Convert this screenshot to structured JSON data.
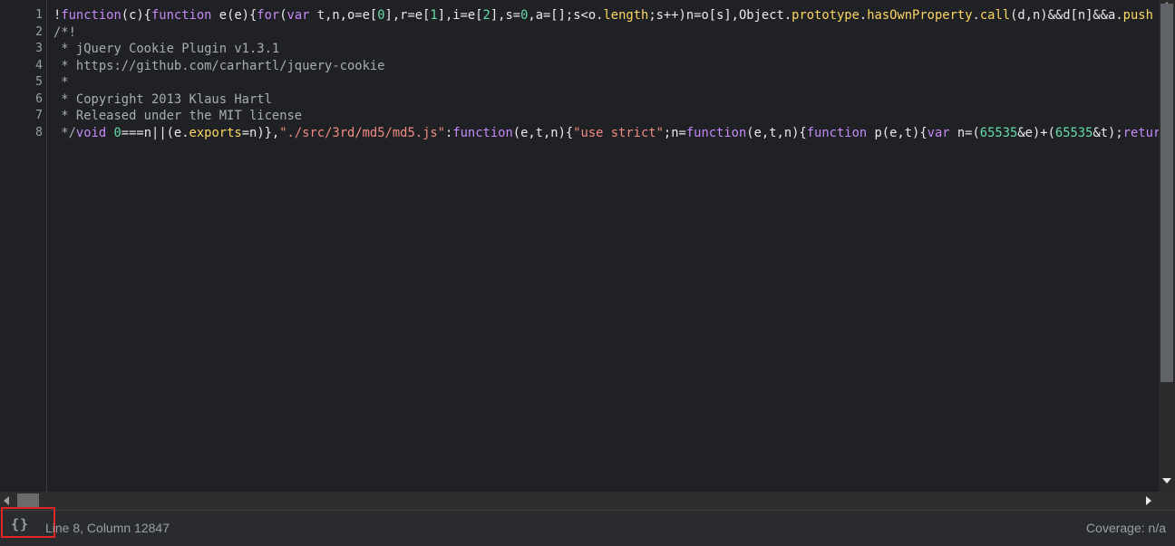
{
  "editor": {
    "line_numbers": [
      "1",
      "2",
      "3",
      "4",
      "5",
      "6",
      "7",
      "8"
    ],
    "lines": [
      [
        {
          "t": "!",
          "c": "pl"
        },
        {
          "t": "function",
          "c": "kw"
        },
        {
          "t": "(c){",
          "c": "pl"
        },
        {
          "t": "function",
          "c": "kw"
        },
        {
          "t": " e(e){",
          "c": "pl"
        },
        {
          "t": "for",
          "c": "kw"
        },
        {
          "t": "(",
          "c": "pl"
        },
        {
          "t": "var",
          "c": "kw"
        },
        {
          "t": " t,n,o=e[",
          "c": "pl"
        },
        {
          "t": "0",
          "c": "num"
        },
        {
          "t": "],r=e[",
          "c": "pl"
        },
        {
          "t": "1",
          "c": "num"
        },
        {
          "t": "],i=e[",
          "c": "pl"
        },
        {
          "t": "2",
          "c": "num"
        },
        {
          "t": "],s=",
          "c": "pl"
        },
        {
          "t": "0",
          "c": "num"
        },
        {
          "t": ",a=[];s<o.",
          "c": "pl"
        },
        {
          "t": "length",
          "c": "prop"
        },
        {
          "t": ";s++)n=o[s],Object.",
          "c": "pl"
        },
        {
          "t": "prototype",
          "c": "prop"
        },
        {
          "t": ".",
          "c": "pl"
        },
        {
          "t": "hasOwnProperty",
          "c": "prop"
        },
        {
          "t": ".",
          "c": "pl"
        },
        {
          "t": "call",
          "c": "prop"
        },
        {
          "t": "(d,n)&&d[n]&&a.",
          "c": "pl"
        },
        {
          "t": "push",
          "c": "prop"
        }
      ],
      [
        {
          "t": "/*!",
          "c": "cm"
        }
      ],
      [
        {
          "t": " * jQuery Cookie Plugin v1.3.1",
          "c": "cm"
        }
      ],
      [
        {
          "t": " * https://github.com/carhartl/jquery-cookie",
          "c": "cm"
        }
      ],
      [
        {
          "t": " *",
          "c": "cm"
        }
      ],
      [
        {
          "t": " * Copyright 2013 Klaus Hartl",
          "c": "cm"
        }
      ],
      [
        {
          "t": " * Released under the MIT license",
          "c": "cm"
        }
      ],
      [
        {
          "t": " */",
          "c": "cm"
        },
        {
          "t": "void",
          "c": "kw"
        },
        {
          "t": " ",
          "c": "pl"
        },
        {
          "t": "0",
          "c": "num"
        },
        {
          "t": "===n||(e.",
          "c": "pl"
        },
        {
          "t": "exports",
          "c": "prop"
        },
        {
          "t": "=n)},",
          "c": "pl"
        },
        {
          "t": "\"./src/3rd/md5/md5.js\"",
          "c": "str"
        },
        {
          "t": ":",
          "c": "pl"
        },
        {
          "t": "function",
          "c": "kw"
        },
        {
          "t": "(e,t,n){",
          "c": "pl"
        },
        {
          "t": "\"use strict\"",
          "c": "str"
        },
        {
          "t": ";n=",
          "c": "pl"
        },
        {
          "t": "function",
          "c": "kw"
        },
        {
          "t": "(e,t,n){",
          "c": "pl"
        },
        {
          "t": "function",
          "c": "kw"
        },
        {
          "t": " p(e,t){",
          "c": "pl"
        },
        {
          "t": "var",
          "c": "kw"
        },
        {
          "t": " n=(",
          "c": "pl"
        },
        {
          "t": "65535",
          "c": "num"
        },
        {
          "t": "&e)+(",
          "c": "pl"
        },
        {
          "t": "65535",
          "c": "num"
        },
        {
          "t": "&t);",
          "c": "pl"
        },
        {
          "t": "return",
          "c": "kw"
        }
      ]
    ]
  },
  "icons": {
    "pretty_print": "curly-braces-icon",
    "scroll_up": "triangle-up-icon",
    "scroll_down": "triangle-down-icon",
    "scroll_left": "triangle-left-icon",
    "scroll_right": "triangle-right-icon"
  },
  "status": {
    "pretty_print_glyph": "{}",
    "cursor_position": "Line 8, Column 12847",
    "coverage": "Coverage: n/a"
  },
  "colors": {
    "highlight_box": "#e02424",
    "keyword": "#c58af9",
    "number": "#66d9a8",
    "string": "#f28b82",
    "property": "#fdd663",
    "comment": "#a8adb3"
  }
}
